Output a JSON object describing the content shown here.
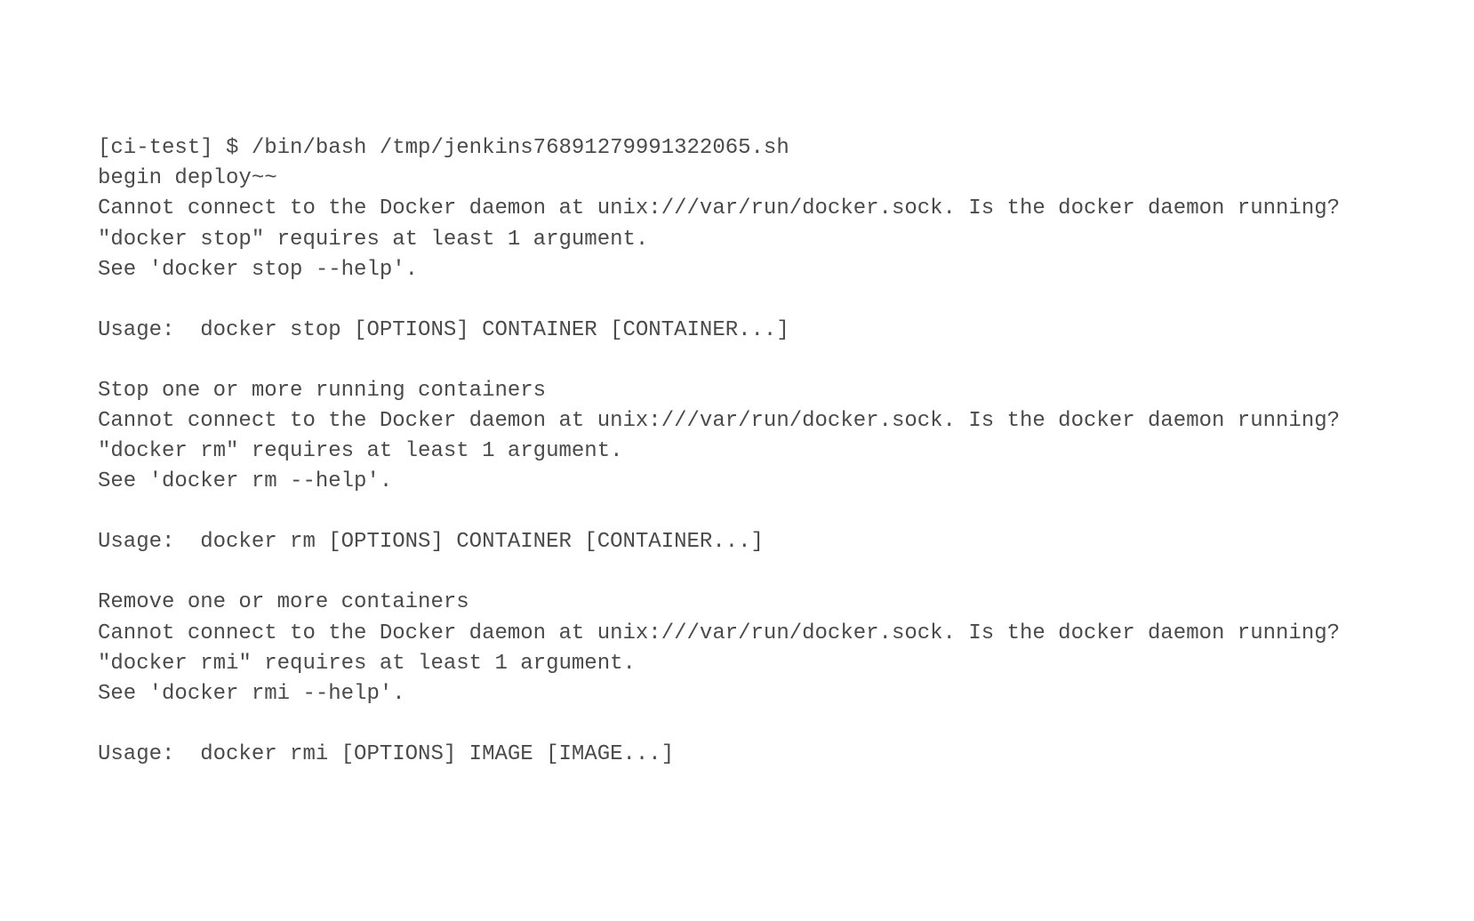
{
  "console": {
    "lines": [
      "[ci-test] $ /bin/bash /tmp/jenkins76891279991322065.sh",
      "begin deploy~~",
      "Cannot connect to the Docker daemon at unix:///var/run/docker.sock. Is the docker daemon running?",
      "\"docker stop\" requires at least 1 argument.",
      "See 'docker stop --help'.",
      "",
      "Usage:  docker stop [OPTIONS] CONTAINER [CONTAINER...]",
      "",
      "Stop one or more running containers",
      "Cannot connect to the Docker daemon at unix:///var/run/docker.sock. Is the docker daemon running?",
      "\"docker rm\" requires at least 1 argument.",
      "See 'docker rm --help'.",
      "",
      "Usage:  docker rm [OPTIONS] CONTAINER [CONTAINER...]",
      "",
      "Remove one or more containers",
      "Cannot connect to the Docker daemon at unix:///var/run/docker.sock. Is the docker daemon running?",
      "\"docker rmi\" requires at least 1 argument.",
      "See 'docker rmi --help'.",
      "",
      "Usage:  docker rmi [OPTIONS] IMAGE [IMAGE...]"
    ]
  }
}
